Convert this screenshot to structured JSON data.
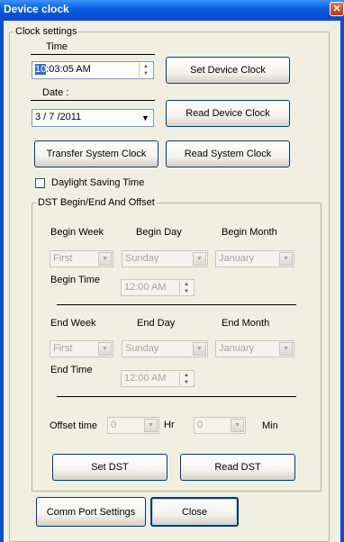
{
  "window": {
    "title": "Device clock",
    "close_glyph": "✕"
  },
  "clock_settings": {
    "legend": "Clock settings",
    "time_label": "Time",
    "time_value_selected": "10",
    "time_value_rest": ":03:05 AM",
    "date_label": "Date :",
    "date_value": "3 / 7 /2011",
    "set_device_clock": "Set Device Clock",
    "read_device_clock": "Read Device Clock",
    "transfer_system_clock": "Transfer System Clock",
    "read_system_clock": "Read System Clock",
    "daylight_saving_label": "Daylight Saving Time"
  },
  "dst": {
    "legend": "DST Begin/End And Offset",
    "begin_week_label": "Begin Week",
    "begin_day_label": "Begin Day",
    "begin_month_label": "Begin Month",
    "begin_week_value": "First",
    "begin_day_value": "Sunday",
    "begin_month_value": "January",
    "begin_time_label": "Begin Time",
    "begin_time_value": "12:00 AM",
    "end_week_label": "End Week",
    "end_day_label": "End Day",
    "end_month_label": "End Month",
    "end_week_value": "First",
    "end_day_value": "Sunday",
    "end_month_value": "January",
    "end_time_label": "End Time",
    "end_time_value": "12:00 AM",
    "offset_time_label": "Offset time",
    "offset_hr_value": "0",
    "hr_label": "Hr",
    "offset_min_value": "0",
    "min_label": "Min",
    "set_dst": "Set DST",
    "read_dst": "Read DST"
  },
  "footer": {
    "comm_port_settings": "Comm Port Settings",
    "close": "Close"
  },
  "icons": {
    "dropdown": "chevron-down-icon",
    "spinner": "spin-arrows-icon"
  },
  "colors": {
    "titlebar": "#0a5fdd",
    "panel": "#f1efe2",
    "selection": "#316ac5"
  }
}
